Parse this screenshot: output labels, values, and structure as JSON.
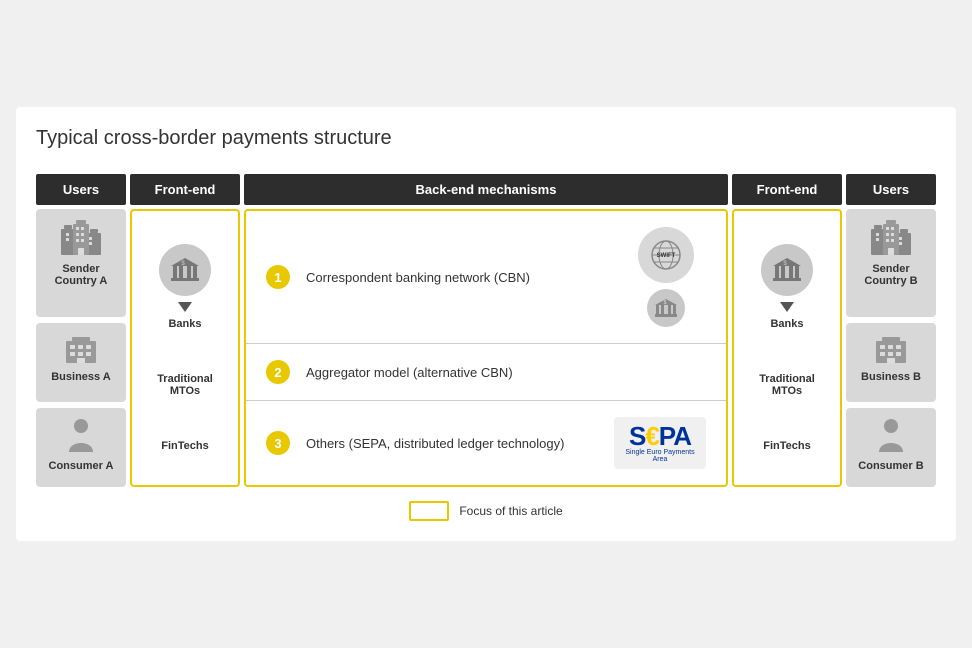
{
  "title": "Typical cross-border payments structure",
  "header": {
    "col1": "Users",
    "col2": "Front-end",
    "col3": "Back-end mechanisms",
    "col4": "Front-end",
    "col5": "Users"
  },
  "left_users": [
    {
      "label": "Sender Country A",
      "type": "building-group"
    },
    {
      "label": "Business A",
      "type": "building-single"
    },
    {
      "label": "Consumer A",
      "type": "person"
    }
  ],
  "right_users": [
    {
      "label": "Sender Country B",
      "type": "building-group"
    },
    {
      "label": "Business B",
      "type": "building-single"
    },
    {
      "label": "Consumer B",
      "type": "person"
    }
  ],
  "left_frontend": {
    "items": [
      {
        "icon": "bank",
        "label": "Banks",
        "sublabel": ""
      },
      {
        "label": "Traditional MTOs",
        "sublabel": ""
      },
      {
        "label": "FinTechs",
        "sublabel": ""
      }
    ]
  },
  "right_frontend": {
    "items": [
      {
        "icon": "bank",
        "label": "Banks",
        "sublabel": ""
      },
      {
        "label": "Traditional MTOs",
        "sublabel": ""
      },
      {
        "label": "FinTechs",
        "sublabel": ""
      }
    ]
  },
  "backend": [
    {
      "number": "1",
      "text": "Correspondent banking network (CBN)"
    },
    {
      "number": "2",
      "text": "Aggregator model (alternative CBN)"
    },
    {
      "number": "3",
      "text": "Others (SEPA, distributed ledger technology)"
    }
  ],
  "legend": {
    "box_label": "",
    "text": "Focus of this article"
  }
}
